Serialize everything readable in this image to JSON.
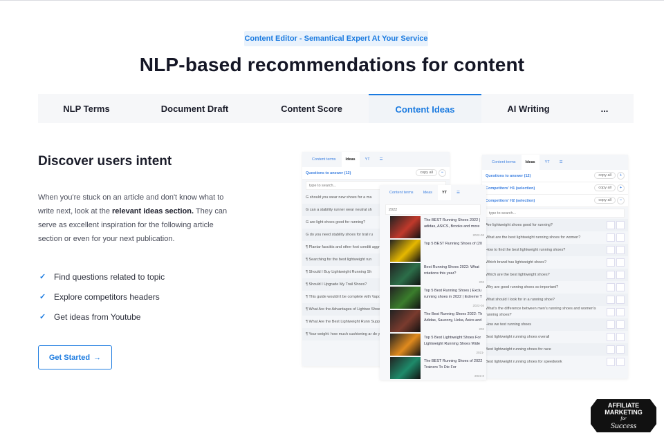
{
  "badge": "Content Editor - Semantical Expert At Your Service",
  "title": "NLP-based recommendations for content",
  "tabs": [
    {
      "label": "NLP Terms"
    },
    {
      "label": "Document Draft"
    },
    {
      "label": "Content Score"
    },
    {
      "label": "Content Ideas",
      "active": true
    },
    {
      "label": "AI Writing"
    },
    {
      "label": "..."
    }
  ],
  "left": {
    "heading": "Discover users intent",
    "p1": "When you're stuck on an article and don't know what to write next, look at the ",
    "p_bold": "relevant ideas section.",
    "p2": " They can serve as excellent inspiration for the following article section or even for your next publication.",
    "features": [
      "Find questions related to topic",
      "Explore competitors headers",
      "Get ideas from Youtube"
    ],
    "button": "Get Started"
  },
  "panel_tabs": [
    "Content terms",
    "Ideas",
    "YT"
  ],
  "panel1": {
    "section": "Questions to answer (12)",
    "copy": "copy all",
    "search": "type to search...",
    "items": [
      "G should you wear new shoes for a ma",
      "G can a stability runner wear neutral sh",
      "G are light shoes good for running?",
      "G do you need stability shoes for trail ru",
      "¶ Plantar fasciitis and other foot conditi aggravate these?",
      "¶ Searching for the best lightweight run",
      "¶ Should I Buy Lightweight Running Sh",
      "¶ Should I Upgrade My Trail Shoes?",
      "¶ This guide wouldn't be complete with Vaporfly Next% 2, would it?",
      "¶ What Are the Advantages of Lightwe Shoes?",
      "¶ What Are the Best Lightweight Runn Support?",
      "¶ Your weight: how much cushioning ar do you need?"
    ]
  },
  "panel2": {
    "search": "2022",
    "videos": [
      {
        "title": "The BEST Running Shoes 2022 | adidas, ASICS, Brooks and more",
        "date": "2022-02"
      },
      {
        "title": "Top 5 BEST Running Shoes of (20",
        "date": ""
      },
      {
        "title": "Best Running Shoes 2022: What rotations this year?",
        "date": "202"
      },
      {
        "title": "Top 5 Best Running Shoes | Exclu running shoes in 2022 | Extreme T",
        "date": "2022-04"
      },
      {
        "title": "The Best Running Shoes 2022: Th Adidas, Saucony, Hoka, Asics and",
        "date": "202"
      },
      {
        "title": "Top 5 Best Lightweight Shoes For Lightweight Running Shoes Wide",
        "date": "2021-"
      },
      {
        "title": "The BEST Running Shoes of 2022 Trainers To Die For",
        "date": "2022-0"
      }
    ]
  },
  "panel3": {
    "sections": [
      {
        "label": "Questions to answer (12)",
        "toggle": "+"
      },
      {
        "label": "Competitors' H1 (selection)",
        "toggle": "+"
      },
      {
        "label": "Competitors' H2 (selection)",
        "toggle": "−"
      }
    ],
    "copy": "copy all",
    "search": "type to search...",
    "items": [
      "Are lightweight shoes good for running?",
      "What are the best lightweight running shoes for women?",
      "How to find the best lightweight running shoes?",
      "Which brand has lightweight shoes?",
      "Which are the best lightweight shoes?",
      "Why are good running shoes so important?",
      "What should I look for in a running shoe?",
      "What's the difference between men's running shoes and women's running shoes?",
      "How we test running shoes",
      "Best lightweight running shoes overall",
      "Best lightweight running shoes for race",
      "Best lightweight running shoes for speedwork"
    ]
  },
  "logo": {
    "line1": "AFFILIATE",
    "line2": "MARKETING",
    "line3": "for",
    "line4": "Success"
  },
  "colors": {
    "accent": "#1a7ae0",
    "badge_bg": "#e9f2fc",
    "tab_bg": "#f6f7f9"
  }
}
